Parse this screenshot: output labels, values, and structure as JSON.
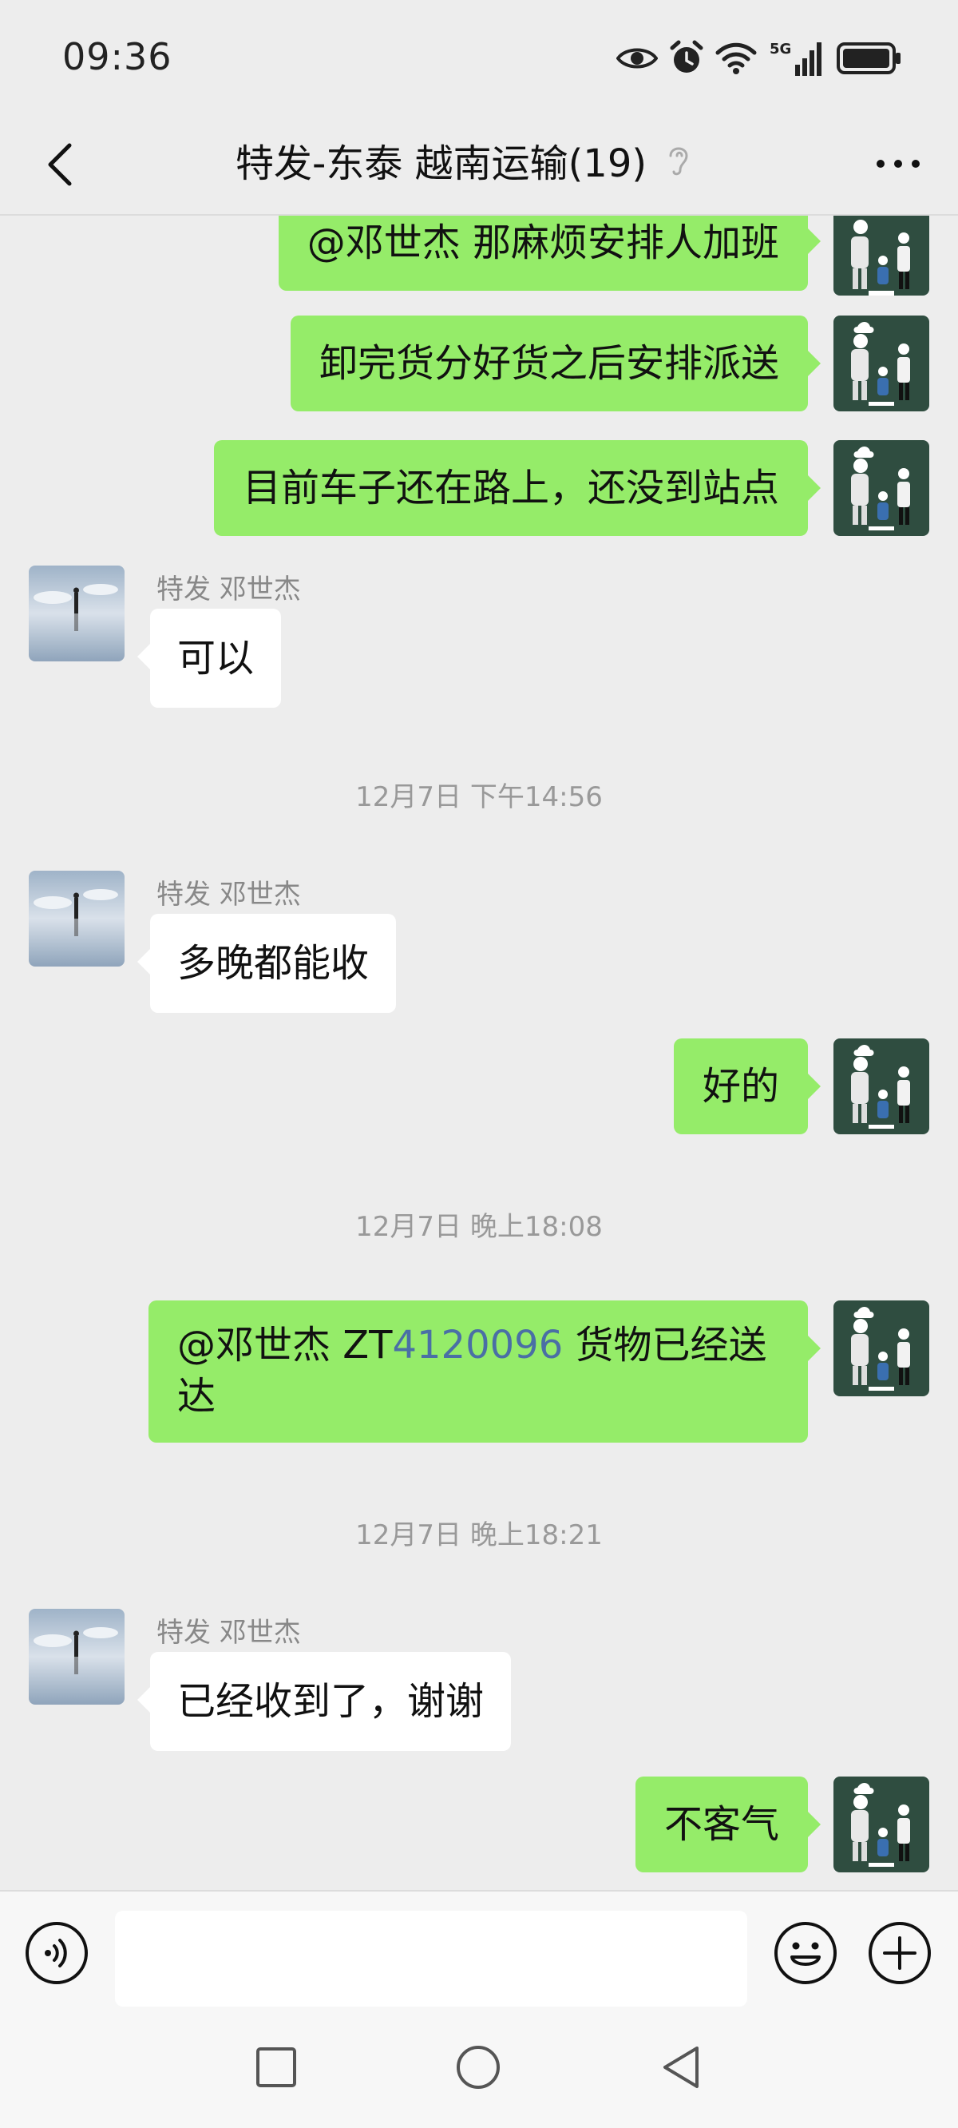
{
  "status_bar": {
    "time": "09:36",
    "network": "5G",
    "icons": [
      "eye-icon",
      "alarm-icon",
      "wifi-icon",
      "signal-icon",
      "battery-icon"
    ]
  },
  "header": {
    "title": "特发-东泰 越南运输(19)",
    "back_icon": "chevron-left-icon",
    "mute_icon": "ear-icon",
    "more_icon": "more-dots-icon"
  },
  "messages": [
    {
      "side": "right",
      "text": "@邓世杰  那麻烦安排人加班"
    },
    {
      "side": "right",
      "text": "卸完货分好货之后安排派送"
    },
    {
      "side": "right",
      "text": "目前车子还在路上，还没到站点"
    },
    {
      "side": "left",
      "sender": "特发 邓世杰",
      "text": "可以"
    },
    {
      "type": "timestamp",
      "text": "12月7日 下午14:56"
    },
    {
      "side": "left",
      "sender": "特发 邓世杰",
      "text": "多晚都能收"
    },
    {
      "side": "right",
      "text": "好的"
    },
    {
      "type": "timestamp",
      "text": "12月7日 晚上18:08"
    },
    {
      "side": "right",
      "text_prefix": "@邓世杰  ZT",
      "text_link": "4120096",
      "text_suffix": " 货物已经送",
      "text_line2": "达"
    },
    {
      "type": "timestamp",
      "text": "12月7日 晚上18:21"
    },
    {
      "side": "left",
      "sender": "特发 邓世杰",
      "text": "已经收到了，谢谢"
    },
    {
      "side": "right",
      "text": "不客气"
    }
  ],
  "input_bar": {
    "placeholder": "",
    "voice_icon": "voice-icon",
    "emoji_icon": "emoji-icon",
    "plus_icon": "plus-icon"
  },
  "colors": {
    "bubble_self": "#95ec69",
    "bubble_other": "#ffffff",
    "background": "#ededed",
    "link": "#4a6fa5"
  }
}
